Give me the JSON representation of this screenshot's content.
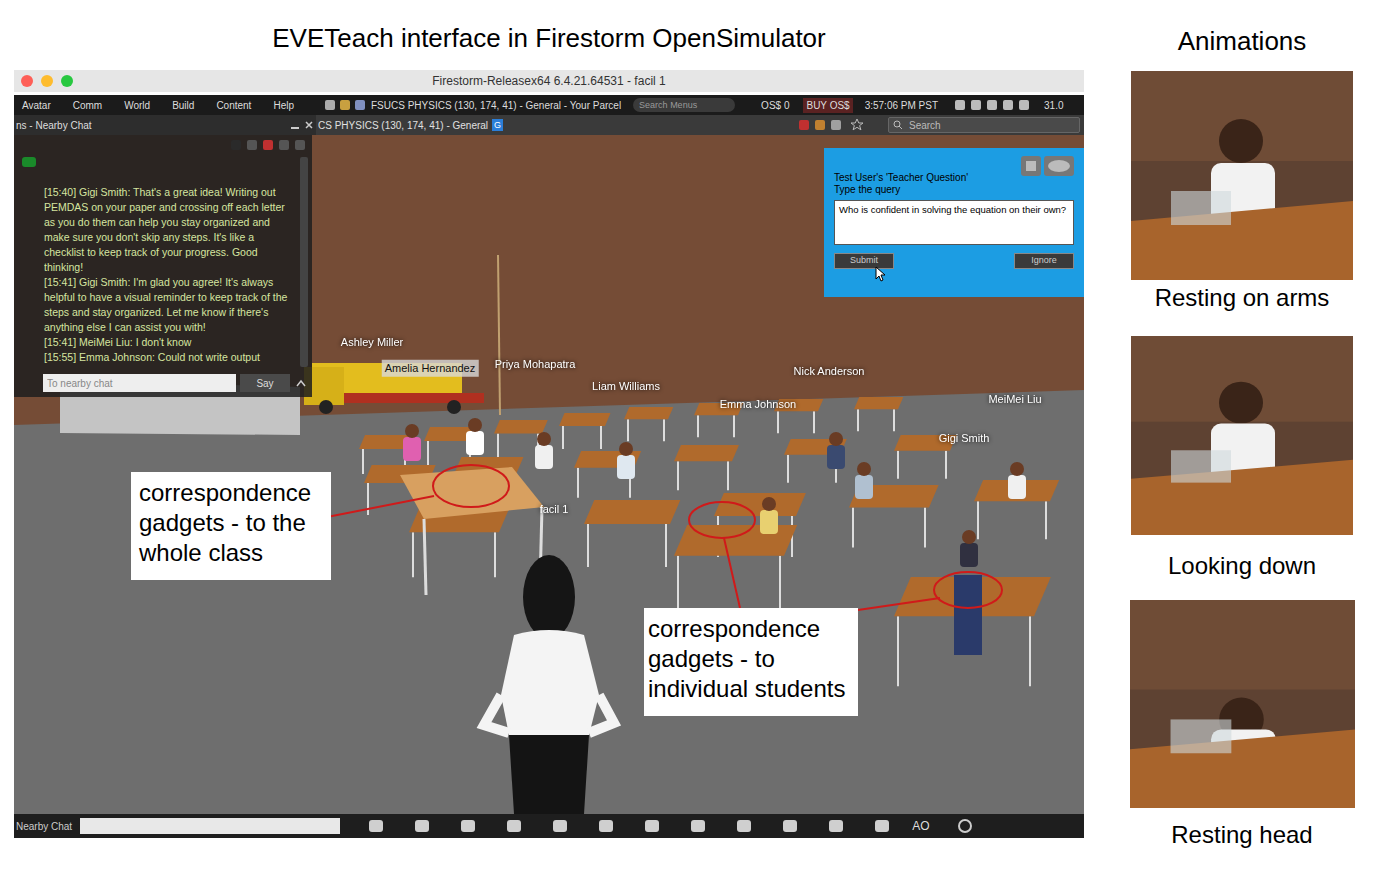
{
  "figure": {
    "title": "EVETeach interface in Firestorm OpenSimulator",
    "side_title": "Animations"
  },
  "window": {
    "title": "Firestorm-Releasex64 6.4.21.64531 - facil 1"
  },
  "menu": [
    "Avatar",
    "Comm",
    "World",
    "Build",
    "Content",
    "Help"
  ],
  "location": "FSUCS PHYSICS (130, 174, 41) - General - Your Parcel",
  "menu_search": {
    "placeholder": "Search Menus"
  },
  "status": {
    "balance": "OS$ 0",
    "buy": "BUY OS$",
    "time": "3:57:06 PM PST",
    "fps": "31.0"
  },
  "nav": {
    "location": "CS PHYSICS (130, 174, 41) - General",
    "badge": "G",
    "search": "Search"
  },
  "chat": {
    "title": "ns - Nearby Chat",
    "messages": [
      "[15:40] Gigi Smith: That's a great idea! Writing out PEMDAS on your paper and crossing off each letter as you do them can help you stay organized and make sure you don't skip any steps. It's like a checklist to keep track of your progress. Good thinking!",
      "[15:41] Gigi Smith: I'm glad you agree! It's always helpful to have a visual reminder to keep track of the steps and stay organized. Let me know if there's anything else I can assist you with!",
      "[15:41] MeiMei Liu: I don't know",
      "[15:55] Emma Johnson: Could not write output"
    ],
    "input_placeholder": "To nearby chat",
    "say": "Say"
  },
  "dialog": {
    "title": "Test User's 'Teacher Question'",
    "prompt": "Type the query",
    "value": "Who is confident in solving the equation on their own?",
    "buttons": [
      "Submit",
      "Ignore"
    ]
  },
  "avatars": [
    {
      "name": "Ashley Miller",
      "highlighted": false
    },
    {
      "name": "Amelia Hernandez",
      "highlighted": true
    },
    {
      "name": "Priya Mohapatra",
      "highlighted": false
    },
    {
      "name": "Liam Williams",
      "highlighted": false
    },
    {
      "name": "Nick Anderson",
      "highlighted": false
    },
    {
      "name": "Emma Johnson",
      "highlighted": false
    },
    {
      "name": "MeiMei Liu",
      "highlighted": false
    },
    {
      "name": "Gigi Smith",
      "highlighted": false
    },
    {
      "name": "facil 1",
      "highlighted": false
    }
  ],
  "callouts": [
    {
      "text": "correspondence gadgets - to the whole class"
    },
    {
      "text": "correspondence gadgets - to individual students"
    }
  ],
  "bottom_bar": {
    "label": "Nearby Chat",
    "ao": "AO"
  },
  "animations": [
    {
      "caption": "Resting on arms"
    },
    {
      "caption": "Looking down"
    },
    {
      "caption": "Resting head"
    }
  ]
}
